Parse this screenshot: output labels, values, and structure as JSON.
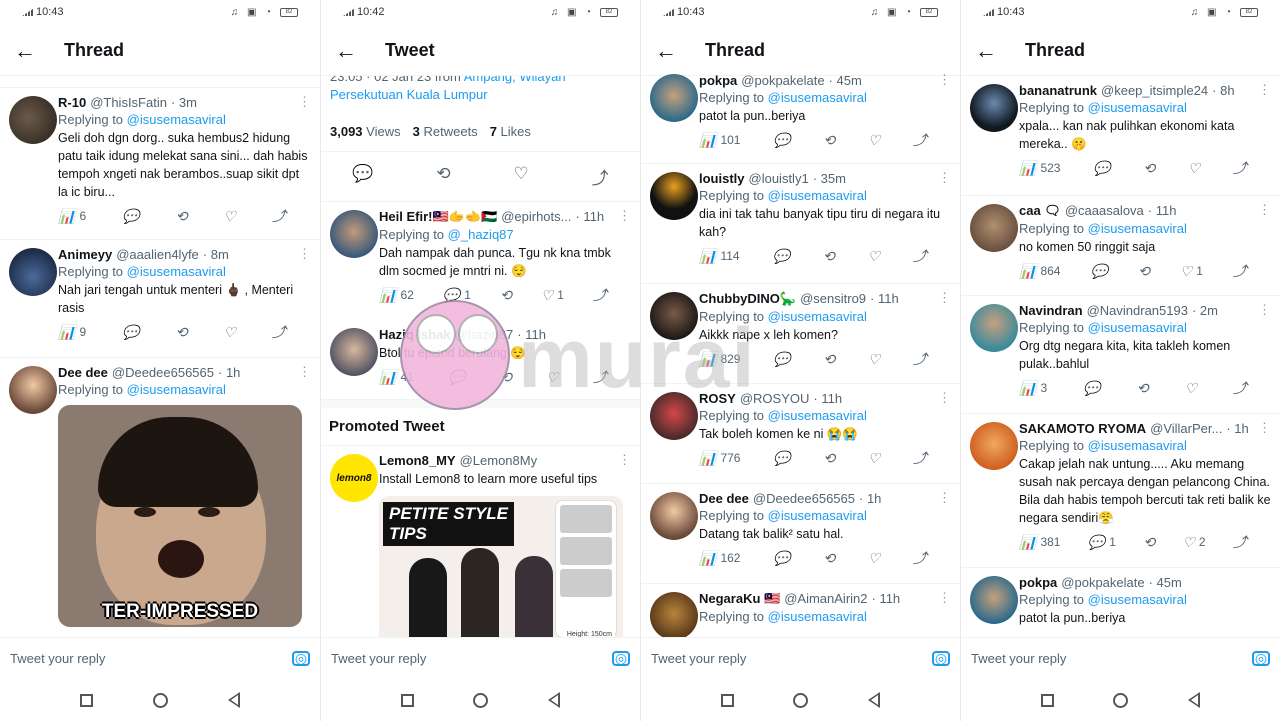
{
  "status_times": [
    "10:43",
    "10:42",
    "10:43",
    "10:43"
  ],
  "battery": "82",
  "panel1": {
    "title": "Thread",
    "tweets": [
      {
        "name": "R-10",
        "handle": "@ThisIsFatin",
        "time": "· 3m",
        "replying_to": "@isusemasaviral",
        "text": "Geli doh dgn dorg.. suka hembus2 hidung patu taik idung melekat sana sini... dah habis tempoh xngeti nak berambos..suap sikit dpt la ic biru...",
        "views": "6",
        "replies": "",
        "retweets": "",
        "likes": ""
      },
      {
        "name": "Animeyy",
        "handle": "@aaalien4lyfe",
        "time": "· 8m",
        "replying_to": "@isusemasaviral",
        "text": "Nah jari tengah untuk menteri 🖕🏿 , Menteri rasis",
        "views": "9",
        "replies": "",
        "retweets": "",
        "likes": ""
      },
      {
        "name": "Dee dee",
        "handle": "@Deedee656565",
        "time": "· 1h",
        "replying_to": "@isusemasaviral",
        "text": "",
        "media_caption": "TER-IMPRESSED"
      }
    ],
    "reply_placeholder": "Tweet your reply"
  },
  "panel2": {
    "title": "Tweet",
    "meta_time": "23:05 · 02 Jan 23 from",
    "meta_location": "Ampang, Wilayah Persekutuan Kuala Lumpur",
    "views": "3,093",
    "views_label": "Views",
    "retweets": "3",
    "retweets_label": "Retweets",
    "likes": "7",
    "likes_label": "Likes",
    "tweets": [
      {
        "name": "Heil Efir!🇲🇾🫱🫲🇵🇸",
        "handle": "@epirhots...",
        "time": "· 11h",
        "replying_to": "@_haziq87",
        "text": "Dah nampak dah punca. Tgu nk kna tmbk dlm socmed je mntri ni. 😌",
        "views": "62",
        "replies": "1",
        "retweets": "",
        "likes": "1"
      },
      {
        "name": "Haziq Ishak",
        "handle": "@haziq87",
        "time": "· 11h",
        "replying_to": "",
        "text": "Btol tu episod berulang 😌",
        "views": "41",
        "replies": "",
        "retweets": "",
        "likes": ""
      }
    ],
    "promoted_label": "Promoted Tweet",
    "ad": {
      "name": "Lemon8_MY",
      "handle": "@Lemon8My",
      "text": "Install Lemon8 to learn more useful tips",
      "logo_text": "lemon8",
      "banner_line1": "PETITE STYLE",
      "banner_line2": "TIPS",
      "height_label": "Height: 150cm"
    },
    "reply_placeholder": "Tweet your reply"
  },
  "panel3": {
    "title": "Thread",
    "tweets": [
      {
        "name": "pokpa",
        "handle": "@pokpakelate",
        "time": "· 45m",
        "replying_to": "@isusemasaviral",
        "text": "patot la pun..beriya",
        "views": "101",
        "replies": "",
        "retweets": "",
        "likes": ""
      },
      {
        "name": "louistly",
        "handle": "@louistly1",
        "time": "· 35m",
        "replying_to": "@isusemasaviral",
        "text": "dia ini tak tahu banyak tipu tiru di negara itu kah?",
        "views": "114",
        "replies": "",
        "retweets": "",
        "likes": ""
      },
      {
        "name": "ChubbyDINO🦕",
        "handle": "@sensitro9",
        "time": "· 11h",
        "replying_to": "@isusemasaviral",
        "text": "Aikkk nape x leh komen?",
        "views": "829",
        "replies": "",
        "retweets": "",
        "likes": ""
      },
      {
        "name": "ROSY",
        "handle": "@ROSYOU",
        "time": "· 11h",
        "replying_to": "@isusemasaviral",
        "text": "Tak boleh komen ke ni 😭😭",
        "views": "776",
        "replies": "",
        "retweets": "",
        "likes": ""
      },
      {
        "name": "Dee dee",
        "handle": "@Deedee656565",
        "time": "· 1h",
        "replying_to": "@isusemasaviral",
        "text": "Datang tak balik² satu hal.",
        "views": "162",
        "replies": "",
        "retweets": "",
        "likes": ""
      },
      {
        "name": "NegaraKu 🇲🇾",
        "handle": "@AimanAirin2",
        "time": "· 11h",
        "replying_to": "@isusemasaviral",
        "text": "",
        "views": "",
        "replies": "",
        "retweets": "",
        "likes": ""
      }
    ],
    "reply_placeholder": "Tweet your reply"
  },
  "panel4": {
    "title": "Thread",
    "tweets": [
      {
        "name": "bananatrunk",
        "handle": "@keep_itsimple24",
        "time": "· 8h",
        "replying_to": "@isusemasaviral",
        "text": "xpala... kan nak pulihkan ekonomi kata mereka.. 🤫",
        "views": "523",
        "replies": "",
        "retweets": "",
        "likes": ""
      },
      {
        "name": "caa 🗨",
        "handle": "@caaasalova",
        "time": "· 11h",
        "replying_to": "@isusemasaviral",
        "text": "no komen 50 ringgit saja",
        "views": "864",
        "replies": "",
        "retweets": "",
        "likes": "1"
      },
      {
        "name": "Navindran",
        "handle": "@Navindran5193",
        "time": "· 2m",
        "replying_to": "@isusemasaviral",
        "text": "Org dtg negara kita, kita takleh komen pulak..bahlul",
        "views": "3",
        "replies": "",
        "retweets": "",
        "likes": ""
      },
      {
        "name": "SAKAMOTO RYOMA",
        "handle": "@VillarPer...",
        "time": "· 1h",
        "replying_to": "@isusemasaviral",
        "text": "Cakap jelah nak untung..... Aku memang susah nak percaya dengan pelancong China. Bila dah habis tempoh bercuti tak reti balik ke negara sendiri😤",
        "views": "381",
        "replies": "1",
        "retweets": "",
        "likes": "2"
      },
      {
        "name": "pokpa",
        "handle": "@pokpakelate",
        "time": "· 45m",
        "replying_to": "@isusemasaviral",
        "text": "patot la pun..beriya",
        "views": "",
        "replies": "",
        "retweets": "",
        "likes": ""
      }
    ],
    "reply_placeholder": "Tweet your reply"
  },
  "replying_prefix": "Replying to",
  "watermark": "murai",
  "colors": {
    "accent": "#1d9bf0",
    "muted": "#536471",
    "text": "#0f1419"
  }
}
